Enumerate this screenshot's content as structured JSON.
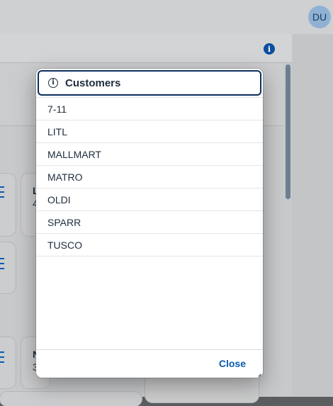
{
  "shell": {
    "avatar_initials": "DU"
  },
  "page": {
    "info_icon": "i",
    "tiles": [
      "L",
      "4",
      "N",
      "3"
    ]
  },
  "dialog": {
    "title": "Customers",
    "title_icon": "i",
    "items": [
      "7-11",
      "LITL",
      "MALLMART",
      "MATRO",
      "OLDI",
      "SPARR",
      "TUSCO"
    ],
    "close_label": "Close"
  }
}
